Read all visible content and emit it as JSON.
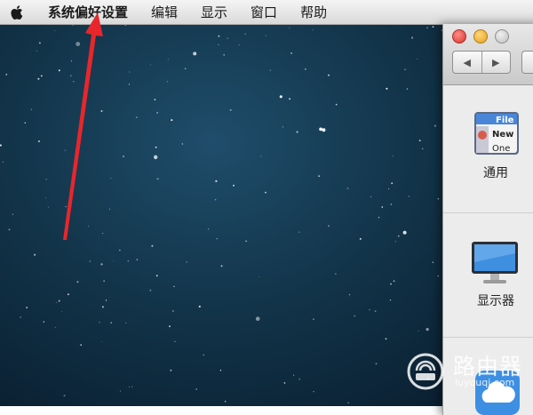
{
  "menubar": {
    "app_name": "系统偏好设置",
    "items": [
      "编辑",
      "显示",
      "窗口",
      "帮助"
    ]
  },
  "window": {
    "nav": {
      "back_glyph": "◀",
      "forward_glyph": "▶"
    },
    "panes": [
      {
        "label": "通用",
        "icon": "general-icon",
        "icon_text": [
          "File",
          "New",
          "One"
        ]
      },
      {
        "label": "显示器",
        "icon": "display-icon"
      },
      {
        "label": "",
        "icon": "icloud-icon"
      }
    ]
  },
  "watermark": {
    "title": "路由器",
    "url": "luyouqi.com"
  },
  "colors": {
    "arrow": "#e8262b",
    "desktop": "#123449"
  }
}
